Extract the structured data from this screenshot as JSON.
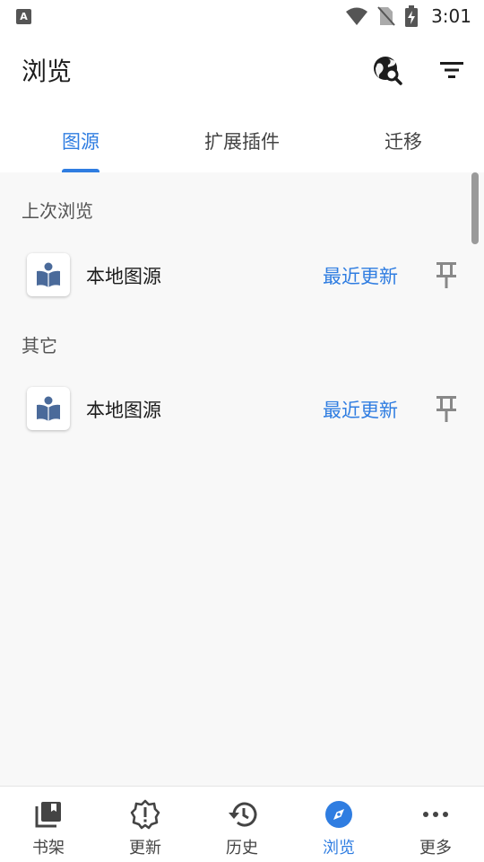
{
  "status_bar": {
    "time": "3:01",
    "left_badge": "A"
  },
  "app_bar": {
    "title": "浏览",
    "icons": [
      "globe-search-icon",
      "filter-icon"
    ]
  },
  "tabs": [
    {
      "label": "图源",
      "active": true
    },
    {
      "label": "扩展插件",
      "active": false
    },
    {
      "label": "迁移",
      "active": false
    }
  ],
  "sections": [
    {
      "header": "上次浏览",
      "items": [
        {
          "label": "本地图源",
          "action": "最近更新"
        }
      ]
    },
    {
      "header": "其它",
      "items": [
        {
          "label": "本地图源",
          "action": "最近更新"
        }
      ]
    }
  ],
  "bottom_nav": [
    {
      "label": "书架",
      "icon": "library-icon",
      "active": false
    },
    {
      "label": "更新",
      "icon": "alert-badge-icon",
      "active": false
    },
    {
      "label": "历史",
      "icon": "history-icon",
      "active": false
    },
    {
      "label": "浏览",
      "icon": "compass-icon",
      "active": true
    },
    {
      "label": "更多",
      "icon": "more-dots-icon",
      "active": false
    }
  ],
  "colors": {
    "accent": "#2f7de1",
    "background": "#f8f8f8"
  }
}
